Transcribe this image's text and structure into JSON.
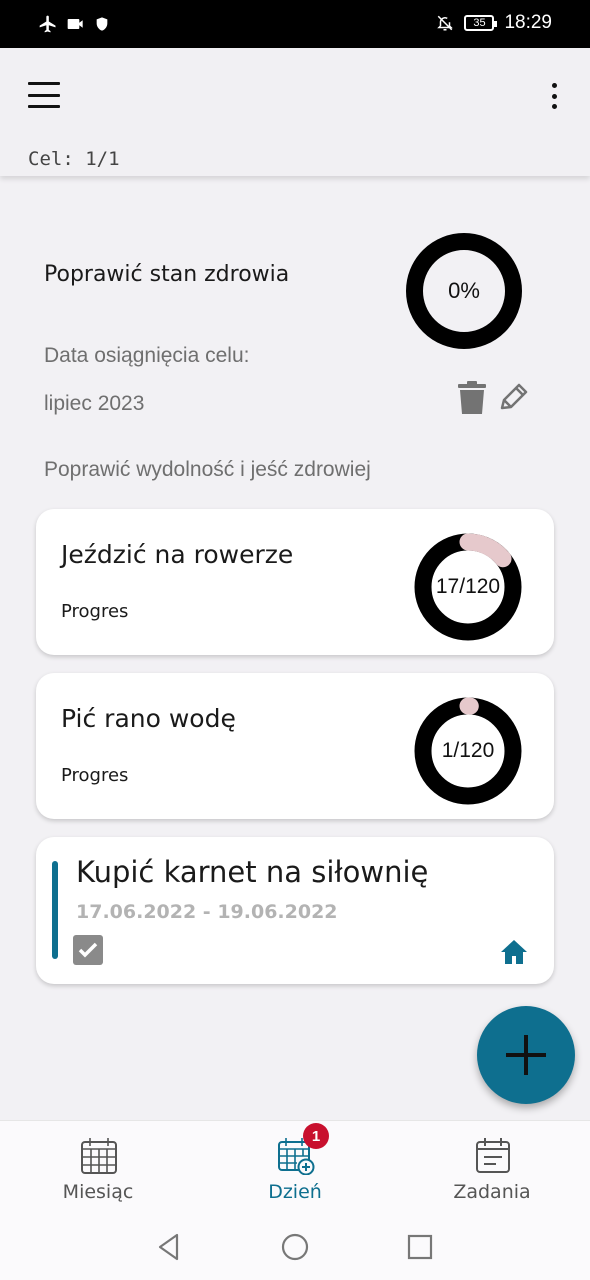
{
  "status_bar": {
    "icons": [
      "airplane-icon",
      "video-icon",
      "shield-icon",
      "bell-off-icon",
      "battery-icon"
    ],
    "battery_level": "35",
    "time": "18:29"
  },
  "app_bar": {
    "menu_icon": "hamburger-icon",
    "more_icon": "more-vert-icon",
    "goal_counter": "Cel: 1/1"
  },
  "goal": {
    "title": "Poprawić stan zdrowia",
    "progress_label": "0%",
    "progress": 0,
    "date_label": "Data osiągnięcia celu:",
    "date": "lipiec 2023",
    "description": "Poprawić wydolność i jeść zdrowiej"
  },
  "habits": [
    {
      "title": "Jeździć na rowerze",
      "subtitle": "Progres",
      "progress_label": "17/120",
      "done": 17,
      "total": 120
    },
    {
      "title": "Pić rano wodę",
      "subtitle": "Progres",
      "progress_label": "1/120",
      "done": 1,
      "total": 120
    }
  ],
  "task": {
    "title": "Kupić karnet na siłownię",
    "dates": "17.06.2022 - 19.06.2022",
    "checked": true,
    "category_icon": "home-icon"
  },
  "bottom_nav": {
    "items": [
      {
        "label": "Miesiąc",
        "icon": "calendar-month-icon",
        "active": false
      },
      {
        "label": "Dzień",
        "icon": "calendar-day-icon",
        "active": true,
        "badge": "1"
      },
      {
        "label": "Zadania",
        "icon": "tasks-icon",
        "active": false
      }
    ]
  },
  "colors": {
    "accent": "#0e6f8f",
    "ring_track": "#000000",
    "ring_progress": "#e6c9cc",
    "badge": "#c8102e",
    "background": "#f2f1f4"
  }
}
